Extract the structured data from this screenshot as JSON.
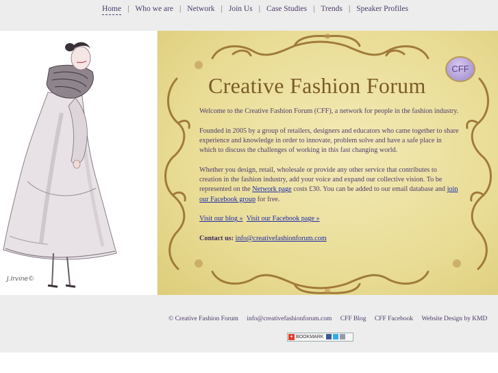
{
  "nav": {
    "items": [
      {
        "label": "Home",
        "active": true
      },
      {
        "label": "Who we are"
      },
      {
        "label": "Network"
      },
      {
        "label": "Join Us"
      },
      {
        "label": "Case Studies"
      },
      {
        "label": "Trends"
      },
      {
        "label": "Speaker Profiles"
      }
    ],
    "separator": "|"
  },
  "illustration": {
    "signature": "J.Irvine©"
  },
  "panel": {
    "badge": "CFF",
    "title": "Creative Fashion Forum",
    "p1": "Welcome to the Creative Fashion Forum (CFF), a network for people in the fashion industry.",
    "p2": "Founded in 2005 by a group of retailers, designers and educators who came together to share experience and knowledge in order to innovate, problem solve and have a safe place in which to discuss the challenges of working in this fast changing world.",
    "p3_before": "Whether you design, retail, wholesale or provide any other service that contributes to creation in the fashion industry, add your voice and expand our collective vision. To be represented on the ",
    "p3_link1": "Network page",
    "p3_mid": " costs £30. You can be added to our email database and ",
    "p3_link2": "join our Facebook group",
    "p3_after": " for free.",
    "blog_link": "Visit our blog »",
    "facebook_link": "Visit our Facebook page »",
    "contact_label": "Contact us:",
    "contact_email": "info@creativefashionforum.com"
  },
  "footer": {
    "copyright": "© Creative Fashion Forum",
    "email": "info@creativefashionforum.com",
    "blog": "CFF Blog",
    "facebook": "CFF Facebook",
    "design": "Website Design by KMD",
    "bookmark_label": "BOOKMARK"
  },
  "colors": {
    "panel_bg": "#e9dc95",
    "ornament": "#a07a3a",
    "text": "#4e3c6e",
    "link": "#1a2aa8"
  }
}
